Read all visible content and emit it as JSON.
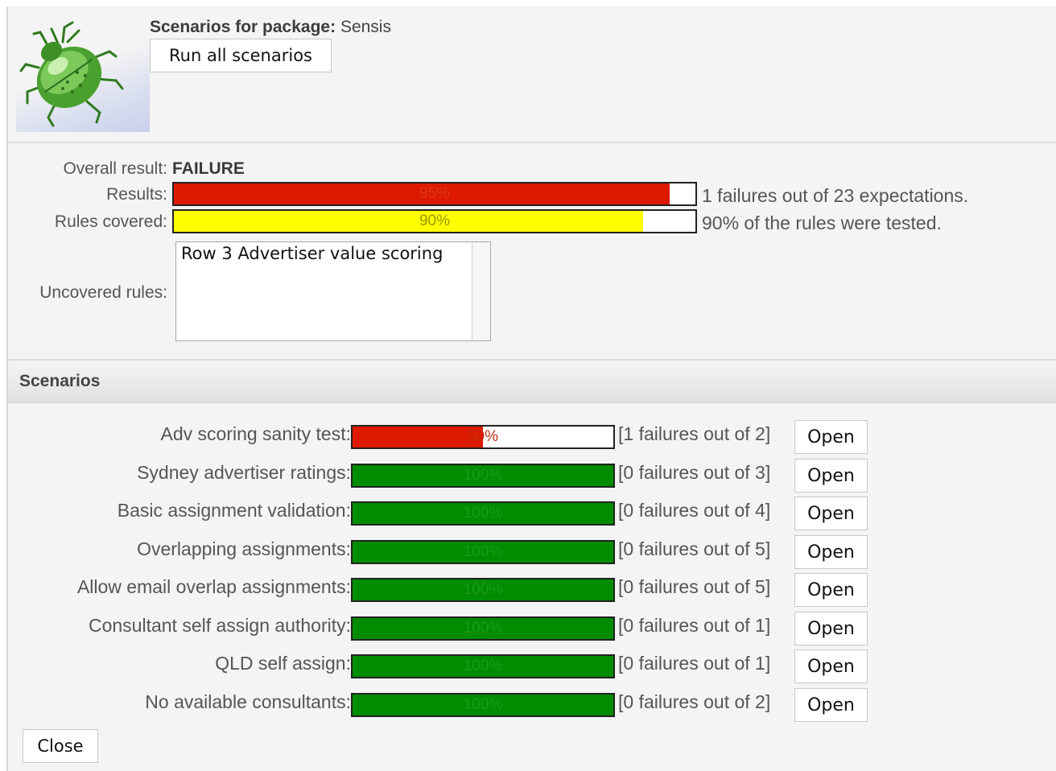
{
  "header": {
    "title_label": "Scenarios for package:",
    "package_name": "Sensis",
    "run_all_label": "Run all scenarios"
  },
  "summary": {
    "overall_label": "Overall result:",
    "overall_value": "FAILURE",
    "results_label": "Results:",
    "results_percent": 95,
    "results_percent_text": "95%",
    "results_text": "1 failures out of 23 expectations.",
    "results_color": "#dd1a00",
    "rules_label": "Rules covered:",
    "rules_percent": 90,
    "rules_percent_text": "90%",
    "rules_text": "90% of the rules were tested.",
    "rules_color": "#ffff00",
    "uncovered_label": "Uncovered rules:",
    "uncovered_items": [
      "Row 3 Advertiser value scoring"
    ]
  },
  "scenarios_section": {
    "title": "Scenarios",
    "open_label": "Open",
    "pass_color": "#008c00",
    "fail_color": "#dd1a00",
    "items": [
      {
        "name": "Adv scoring sanity test:",
        "percent": 50,
        "percent_text": "50%",
        "count_text": "[1 failures out of 2]",
        "status": "fail"
      },
      {
        "name": "Sydney advertiser ratings:",
        "percent": 100,
        "percent_text": "100%",
        "count_text": "[0 failures out of 3]",
        "status": "pass"
      },
      {
        "name": "Basic assignment validation:",
        "percent": 100,
        "percent_text": "100%",
        "count_text": "[0 failures out of 4]",
        "status": "pass"
      },
      {
        "name": "Overlapping assignments:",
        "percent": 100,
        "percent_text": "100%",
        "count_text": "[0 failures out of 5]",
        "status": "pass"
      },
      {
        "name": "Allow email overlap assignments:",
        "percent": 100,
        "percent_text": "100%",
        "count_text": "[0 failures out of 5]",
        "status": "pass"
      },
      {
        "name": "Consultant self assign authority:",
        "percent": 100,
        "percent_text": "100%",
        "count_text": "[0 failures out of 1]",
        "status": "pass"
      },
      {
        "name": "QLD self assign:",
        "percent": 100,
        "percent_text": "100%",
        "count_text": "[0 failures out of 1]",
        "status": "pass"
      },
      {
        "name": "No available consultants:",
        "percent": 100,
        "percent_text": "100%",
        "count_text": "[0 failures out of 2]",
        "status": "pass"
      }
    ]
  },
  "footer": {
    "close_label": "Close"
  }
}
